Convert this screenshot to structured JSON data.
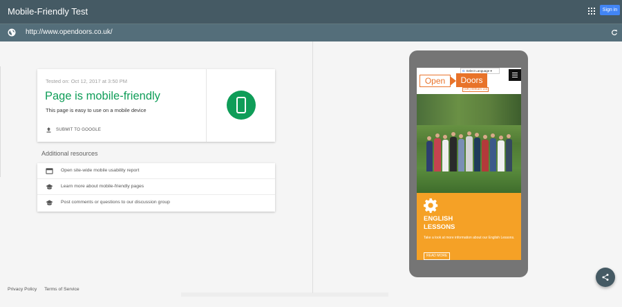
{
  "header": {
    "title": "Mobile-Friendly Test",
    "sign_in_label": "Sign in",
    "apps_icon": "apps-grid-icon"
  },
  "urlbar": {
    "url": "http://www.opendoors.co.uk/",
    "left_icon": "globe-icon",
    "right_icon": "refresh-icon"
  },
  "result": {
    "tested_on": "Tested on: Oct 12, 2017 at 3:50 PM",
    "title": "Page is mobile-friendly",
    "subtitle": "This page is easy to use on a mobile device",
    "submit_label": "SUBMIT TO GOOGLE",
    "status_color": "#0f9d58"
  },
  "resources": {
    "title": "Additional resources",
    "items": [
      {
        "label": "Open site-wide mobile usability report",
        "icon": "browser-window-icon"
      },
      {
        "label": "Learn more about mobile-friendly pages",
        "icon": "graduation-cap-icon"
      },
      {
        "label": "Post comments or questions to our discussion group",
        "icon": "graduation-cap-icon"
      }
    ]
  },
  "footer": {
    "privacy": "Privacy Policy",
    "terms": "Terms of Service"
  },
  "preview": {
    "translate_label": "Select Language",
    "logo_open": "Open",
    "logo_doors": "Doors",
    "logo_sub": "(UK) Eltham Ltd",
    "panel_title_line1": "ENGLISH",
    "panel_title_line2": "LESSONS",
    "panel_text": "Take a look at more information about our English Lessons.",
    "read_more": "READ MORE",
    "accent_color": "#f5a126"
  }
}
